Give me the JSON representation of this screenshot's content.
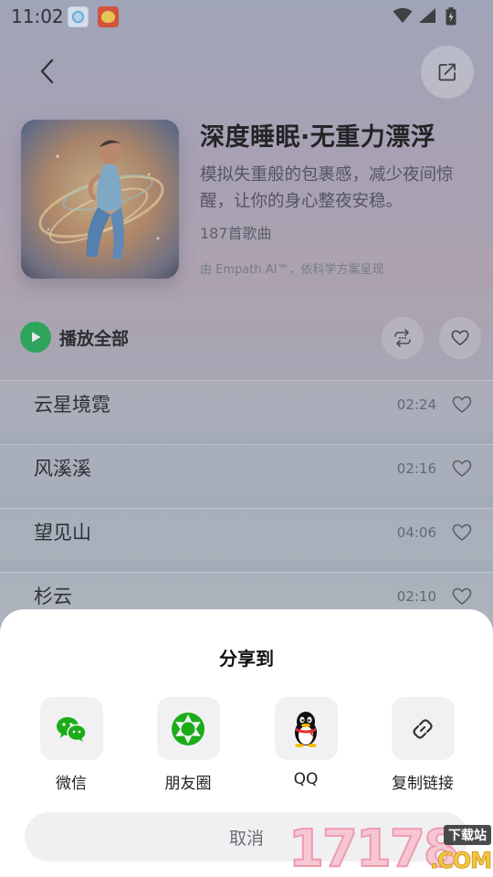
{
  "status_bar": {
    "time": "11:02",
    "icons": [
      "browser-app-icon",
      "game-app-icon",
      "wifi-icon",
      "signal-icon",
      "battery-icon"
    ]
  },
  "header": {
    "back_icon": "chevron-left-icon",
    "share_icon": "share-icon"
  },
  "playlist": {
    "title": "深度睡眠·无重力漂浮",
    "description": "模拟失重般的包裹感，减少夜间惊醒，让你的身心整夜安稳。",
    "song_count": "187首歌曲",
    "credit": "由 Empath AI™，依科学方案呈现"
  },
  "controls": {
    "play_all_label": "播放全部",
    "play_icon": "play-icon",
    "loop_icon": "loop-icon",
    "favorite_icon": "heart-icon"
  },
  "songs": [
    {
      "title": "云星境霓",
      "duration": "02:24"
    },
    {
      "title": "风溪溪",
      "duration": "02:16"
    },
    {
      "title": "望见山",
      "duration": "04:06"
    },
    {
      "title": "杉云",
      "duration": "02:10"
    }
  ],
  "share_sheet": {
    "title": "分享到",
    "options": [
      {
        "label": "微信",
        "icon": "wechat-icon"
      },
      {
        "label": "朋友圈",
        "icon": "moments-icon"
      },
      {
        "label": "QQ",
        "icon": "qq-icon"
      },
      {
        "label": "复制链接",
        "icon": "link-icon"
      }
    ],
    "cancel_label": "取消"
  },
  "watermark": {
    "digits": "17178",
    "tag": "下载站",
    "suffix": ".COM"
  },
  "colors": {
    "accent_green": "#1fae52",
    "wechat_green": "#1aad19"
  }
}
